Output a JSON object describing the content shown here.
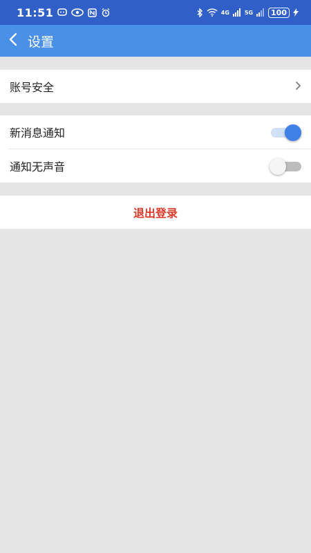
{
  "status_bar": {
    "time": "11:51",
    "battery": "100",
    "net1": "4G",
    "net2": "5G"
  },
  "app_bar": {
    "back_icon": "chevron-left-icon",
    "title": "设置"
  },
  "groups": {
    "account_security": {
      "label": "账号安全",
      "chevron_icon": "chevron-right-icon"
    },
    "new_message_notify": {
      "label": "新消息通知",
      "enabled": true
    },
    "silent_notify": {
      "label": "通知无声音",
      "enabled": false
    },
    "logout": {
      "label": "退出登录"
    }
  },
  "colors": {
    "status_bar": "#2f5fc7",
    "app_bar": "#4a90e8",
    "background": "#e5e5e5",
    "accent": "#3f7fe6",
    "logout_text": "#d93b2a"
  }
}
